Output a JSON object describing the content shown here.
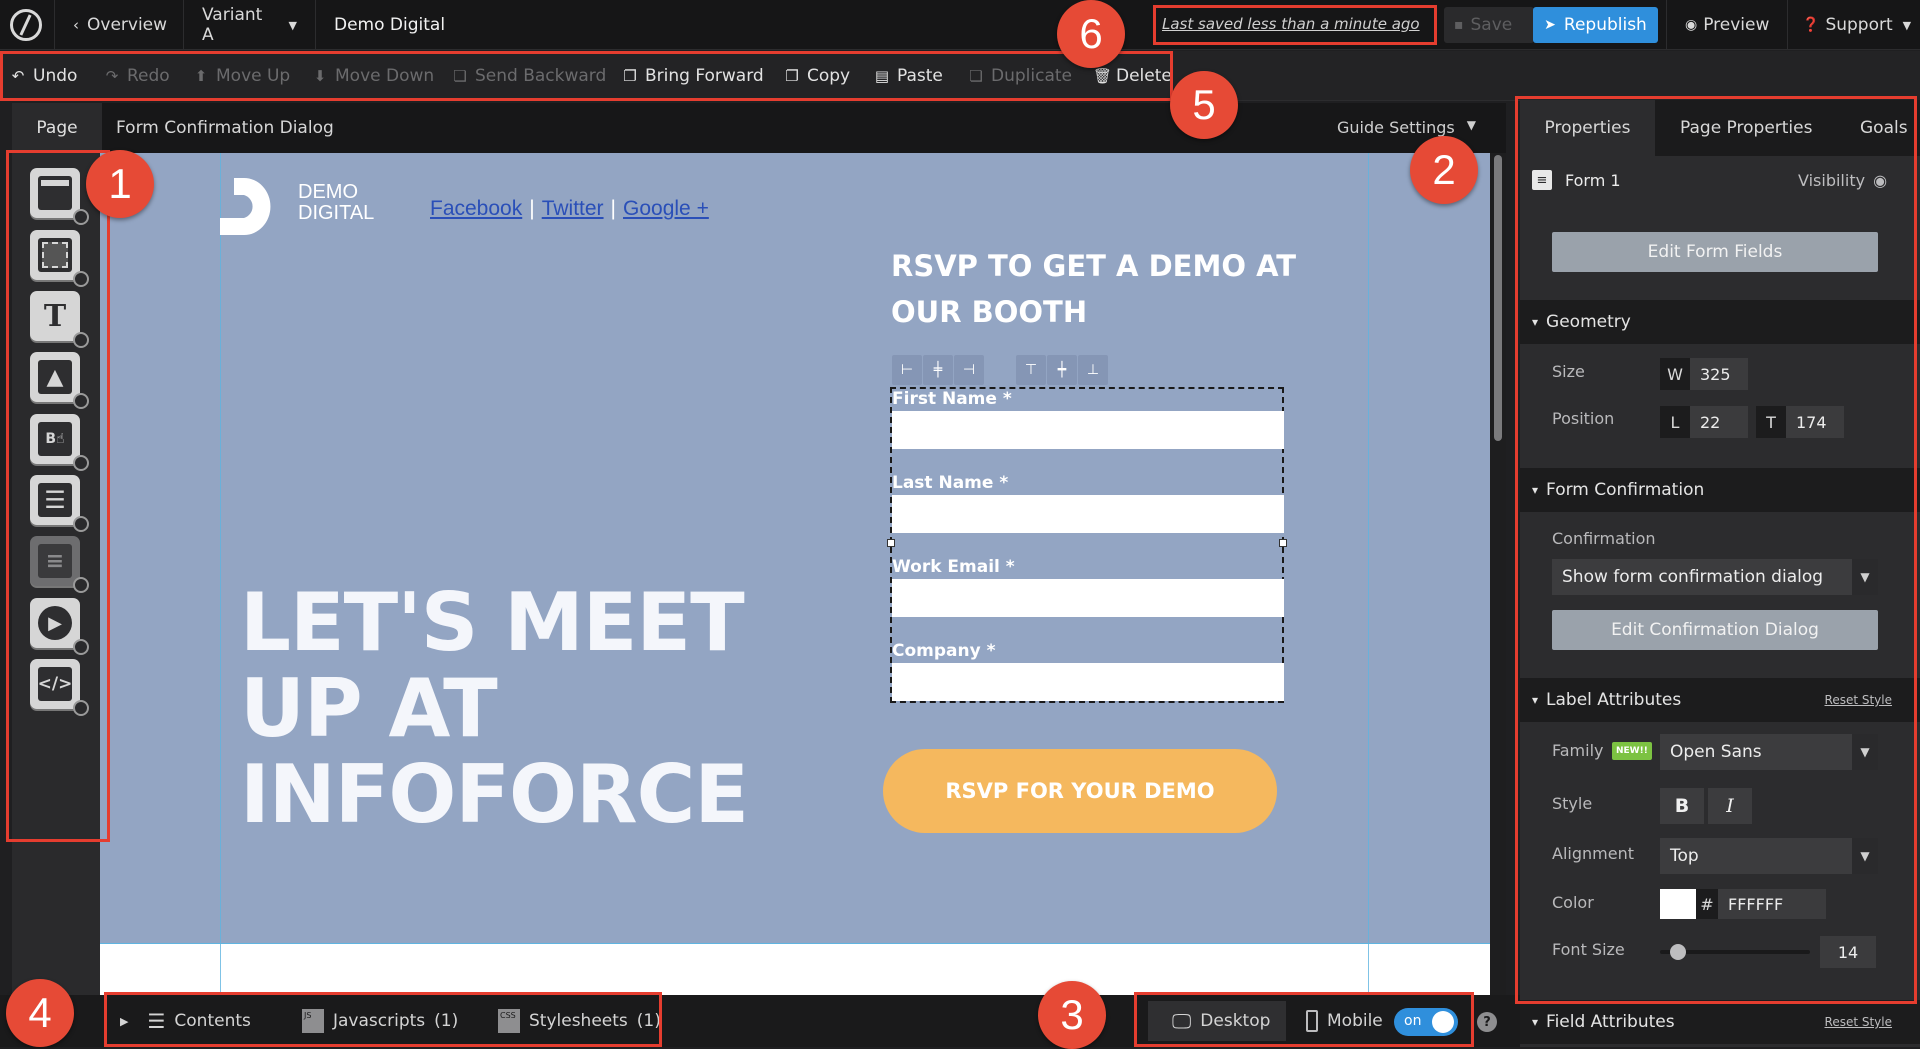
{
  "topbar": {
    "back_label": "Overview",
    "variant_label": "Variant A",
    "page_name": "Demo Digital",
    "last_saved": "Last saved  less than a minute ago",
    "save_label": "Save",
    "republish_label": "Republish",
    "preview_label": "Preview",
    "support_label": "Support"
  },
  "toolbar": {
    "undo": "Undo",
    "redo": "Redo",
    "move_up": "Move Up",
    "move_down": "Move Down",
    "send_backward": "Send Backward",
    "bring_forward": "Bring Forward",
    "copy": "Copy",
    "paste": "Paste",
    "duplicate": "Duplicate",
    "delete": "Delete"
  },
  "pagebar": {
    "page_tab": "Page",
    "element_name": "Form Confirmation Dialog",
    "guide_settings": "Guide Settings"
  },
  "left_tools": [
    "section-icon",
    "box-icon",
    "text-icon",
    "image-icon",
    "button-icon",
    "form-icon",
    "social-icon",
    "video-icon",
    "custom-html-icon"
  ],
  "canvas": {
    "logo_line1": "DEMO",
    "logo_line2": "DIGITAL",
    "social_facebook": "Facebook",
    "social_twitter": "Twitter",
    "social_google": "Google +",
    "social_sep": "|",
    "rsvp_heading_line1": "RSVP TO GET A DEMO AT",
    "rsvp_heading_line2": "OUR BOOTH",
    "hero_line1": "LET'S MEET",
    "hero_line2": "UP AT",
    "hero_line3": "INFOFORCE",
    "form_fields": [
      "First Name *",
      "Last Name *",
      "Work Email *",
      "Company *"
    ],
    "cta_label": "RSVP FOR YOUR DEMO",
    "colors": {
      "hero_bg": "#93a5c3",
      "cta_bg": "#f5b85e",
      "text": "#ffffff"
    }
  },
  "right_panel": {
    "tabs": [
      "Properties",
      "Page Properties",
      "Goals"
    ],
    "element_label": "Form 1",
    "visibility_label": "Visibility",
    "edit_form_fields": "Edit Form Fields",
    "geometry": {
      "title": "Geometry",
      "size_label": "Size",
      "w_prefix": "W",
      "w_value": "325",
      "position_label": "Position",
      "l_prefix": "L",
      "l_value": "22",
      "t_prefix": "T",
      "t_value": "174"
    },
    "form_confirmation": {
      "title": "Form Confirmation",
      "confirmation_label": "Confirmation",
      "confirmation_value": "Show form confirmation dialog",
      "edit_dialog": "Edit Confirmation Dialog"
    },
    "label_attributes": {
      "title": "Label Attributes",
      "reset": "Reset Style",
      "family_label": "Family",
      "new_badge": "NEW!!",
      "family_value": "Open Sans",
      "style_label": "Style",
      "bold": "B",
      "italic": "I",
      "alignment_label": "Alignment",
      "alignment_value": "Top",
      "color_label": "Color",
      "color_hash": "#",
      "color_value": "FFFFFF",
      "font_size_label": "Font Size",
      "font_size_value": "14",
      "font_size_slider_fraction": 0.12
    },
    "field_attributes": {
      "title": "Field Attributes",
      "reset": "Reset Style"
    }
  },
  "bottombar": {
    "contents": "Contents",
    "javascripts": "Javascripts",
    "javascripts_count": "(1)",
    "stylesheets": "Stylesheets",
    "stylesheets_count": "(1)",
    "desktop": "Desktop",
    "mobile": "Mobile",
    "toggle_label": "on",
    "help": "?"
  },
  "callouts": [
    "1",
    "2",
    "3",
    "4",
    "5",
    "6"
  ]
}
